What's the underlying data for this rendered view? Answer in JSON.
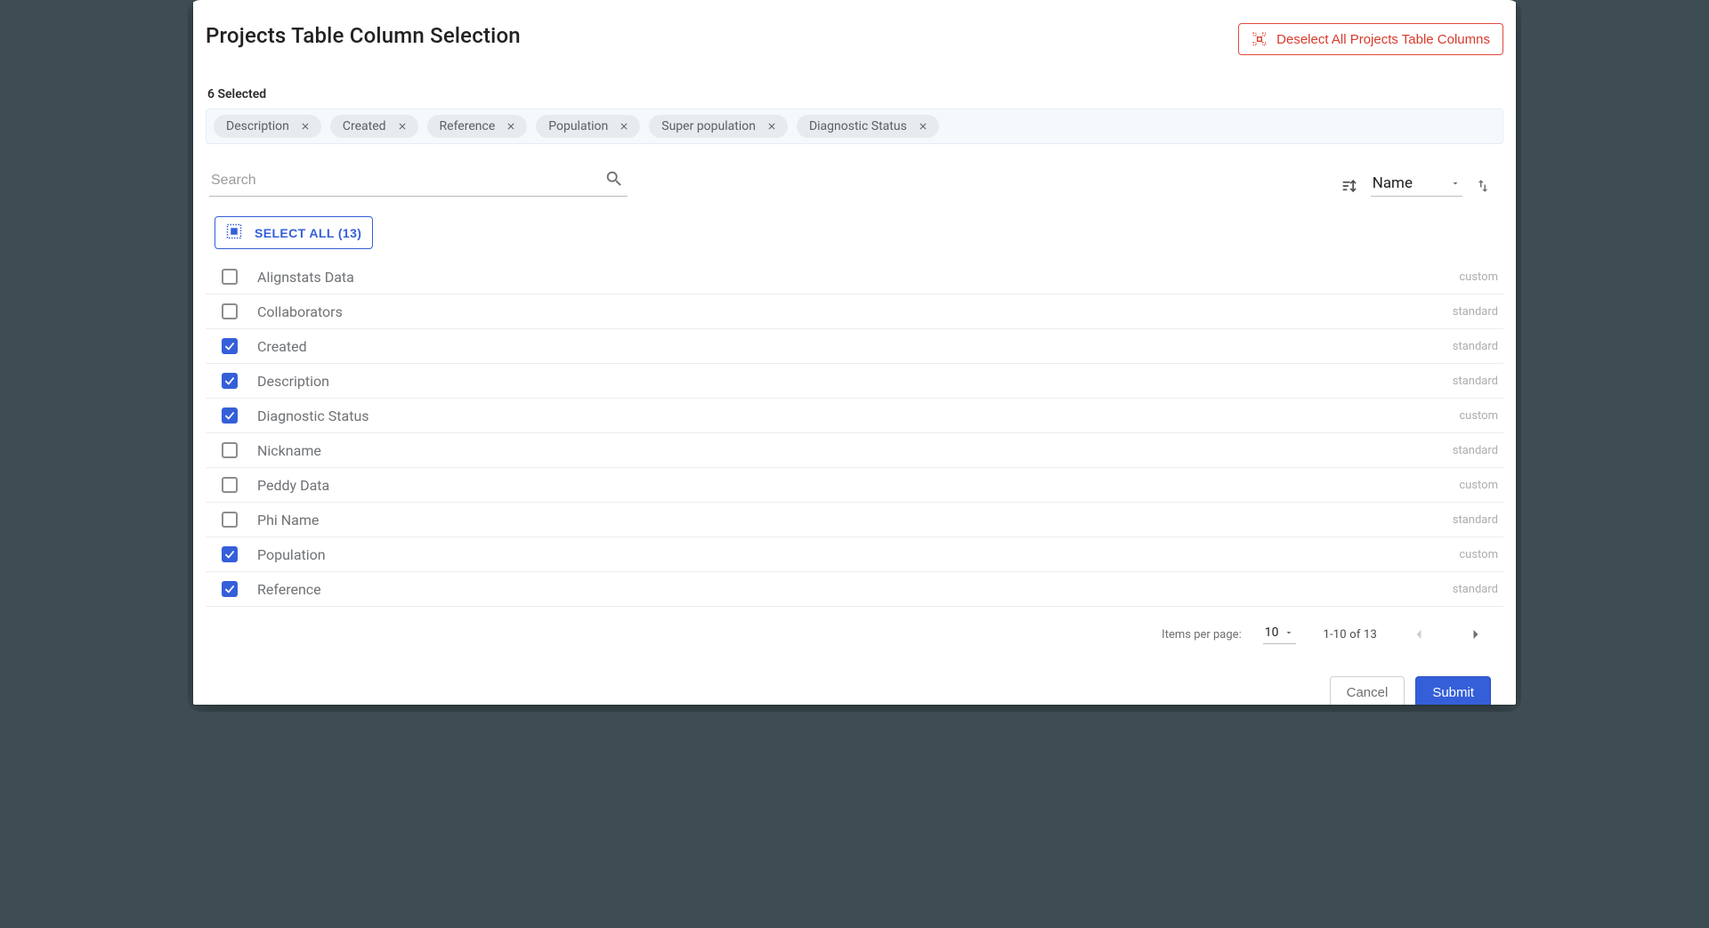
{
  "dialog": {
    "title": "Projects Table Column Selection",
    "deselect_label": "Deselect All Projects Table Columns",
    "selected_count_label": "6 Selected",
    "chips": [
      "Description",
      "Created",
      "Reference",
      "Population",
      "Super population",
      "Diagnostic Status"
    ],
    "search_placeholder": "Search",
    "sort": {
      "field_label": "Name"
    },
    "select_all_label": "SELECT ALL (13)",
    "columns": [
      {
        "label": "Alignstats Data",
        "type": "custom",
        "checked": false
      },
      {
        "label": "Collaborators",
        "type": "standard",
        "checked": false
      },
      {
        "label": "Created",
        "type": "standard",
        "checked": true
      },
      {
        "label": "Description",
        "type": "standard",
        "checked": true
      },
      {
        "label": "Diagnostic Status",
        "type": "custom",
        "checked": true
      },
      {
        "label": "Nickname",
        "type": "standard",
        "checked": false
      },
      {
        "label": "Peddy Data",
        "type": "custom",
        "checked": false
      },
      {
        "label": "Phi Name",
        "type": "standard",
        "checked": false
      },
      {
        "label": "Population",
        "type": "custom",
        "checked": true
      },
      {
        "label": "Reference",
        "type": "standard",
        "checked": true
      }
    ],
    "pager": {
      "items_per_page_label": "Items per page:",
      "items_per_page_value": "10",
      "range_label": "1-10 of 13"
    },
    "cancel_label": "Cancel",
    "submit_label": "Submit"
  }
}
